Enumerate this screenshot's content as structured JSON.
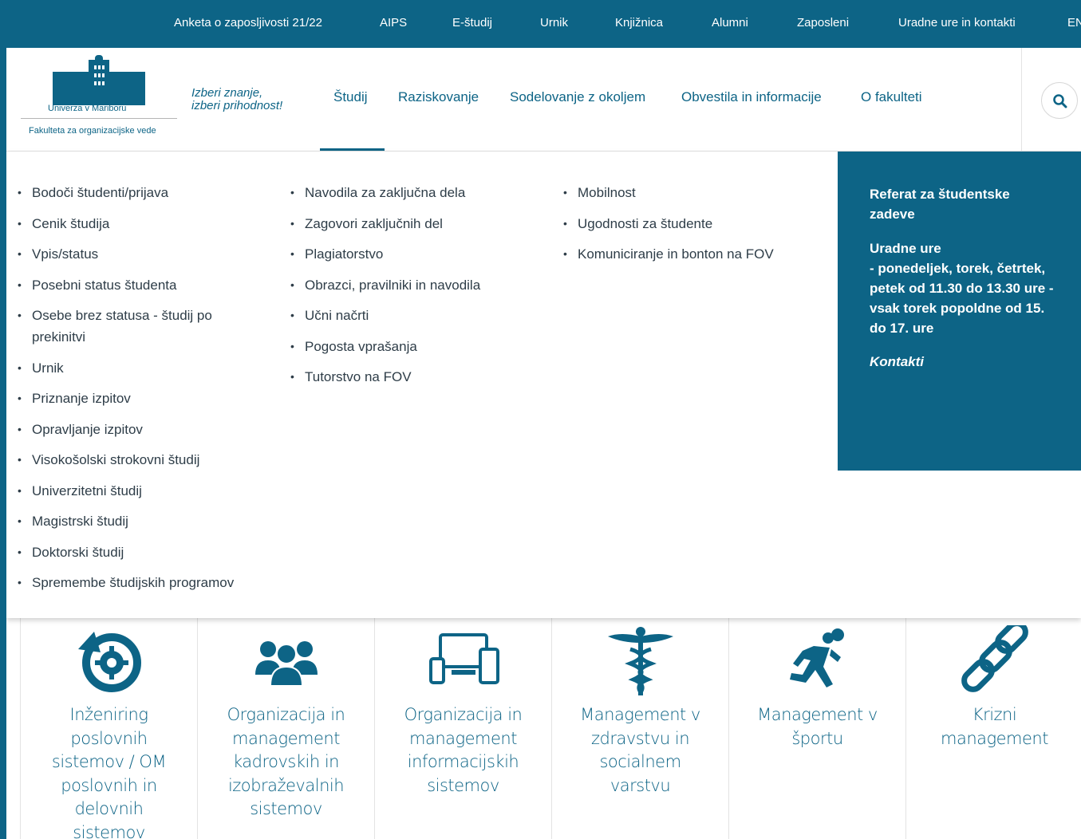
{
  "topbar": {
    "links": [
      "Anketa o zaposljivosti 21/22",
      "AIPS",
      "E-študij",
      "Urnik",
      "Knjižnica",
      "Alumni",
      "Zaposleni",
      "Uradne ure in kontakti",
      "EN"
    ]
  },
  "logo": {
    "university": "Univerza v Mariboru",
    "faculty": "Fakulteta za organizacijske vede"
  },
  "slogan": "Izberi znanje,\nizberi prihodnost!",
  "mainnav": {
    "items": [
      "Študij",
      "Raziskovanje",
      "Sodelovanje z okoljem",
      "Obvestila in informacije",
      "O fakulteti"
    ],
    "active": "Študij",
    "search_icon": "search-icon"
  },
  "dropdown": {
    "col1": [
      "Bodoči študenti/prijava",
      "Cenik študija",
      "Vpis/status",
      "Posebni status študenta",
      "Osebe brez statusa - študij po prekinitvi",
      "Urnik",
      "Priznanje izpitov",
      "Opravljanje izpitov",
      "Visokošolski strokovni študij",
      "Univerzitetni študij",
      "Magistrski študij",
      "Doktorski študij",
      "Spremembe študijskih programov"
    ],
    "col2": [
      "Navodila za zaključna dela",
      "Zagovori zaključnih del",
      "Plagiatorstvo",
      "Obrazci, pravilniki in navodila",
      "Učni načrti",
      "Pogosta vprašanja",
      "Tutorstvo na FOV"
    ],
    "col3": [
      "Mobilnost",
      "Ugodnosti za študente",
      "Komuniciranje in bonton na FOV"
    ],
    "info": {
      "title": "Referat za študentske zadeve",
      "hours_title": "Uradne ure",
      "hours": "- ponedeljek, torek, četrtek, petek od 11.30 do 13.30 ure - vsak torek popoldne od 15. do 17. ure",
      "contact_link": "Kontakti"
    }
  },
  "programs": [
    {
      "label": "Inženiring poslovnih sistemov / OM poslovnih in delovnih sistemov",
      "icon": "gear-cycle-icon"
    },
    {
      "label": "Organizacija in management kadrovskih in izobraževalnih sistemov",
      "icon": "people-group-icon"
    },
    {
      "label": "Organizacija in management informacijskih sistemov",
      "icon": "devices-icon"
    },
    {
      "label": "Management v zdravstvu in socialnem varstvu",
      "icon": "caduceus-icon"
    },
    {
      "label": "Management v športu",
      "icon": "runner-icon"
    },
    {
      "label": "Krizni management",
      "icon": "chain-icon"
    }
  ],
  "colors": {
    "primary": "#0d6486",
    "text": "#2e3d48",
    "white": "#ffffff"
  }
}
